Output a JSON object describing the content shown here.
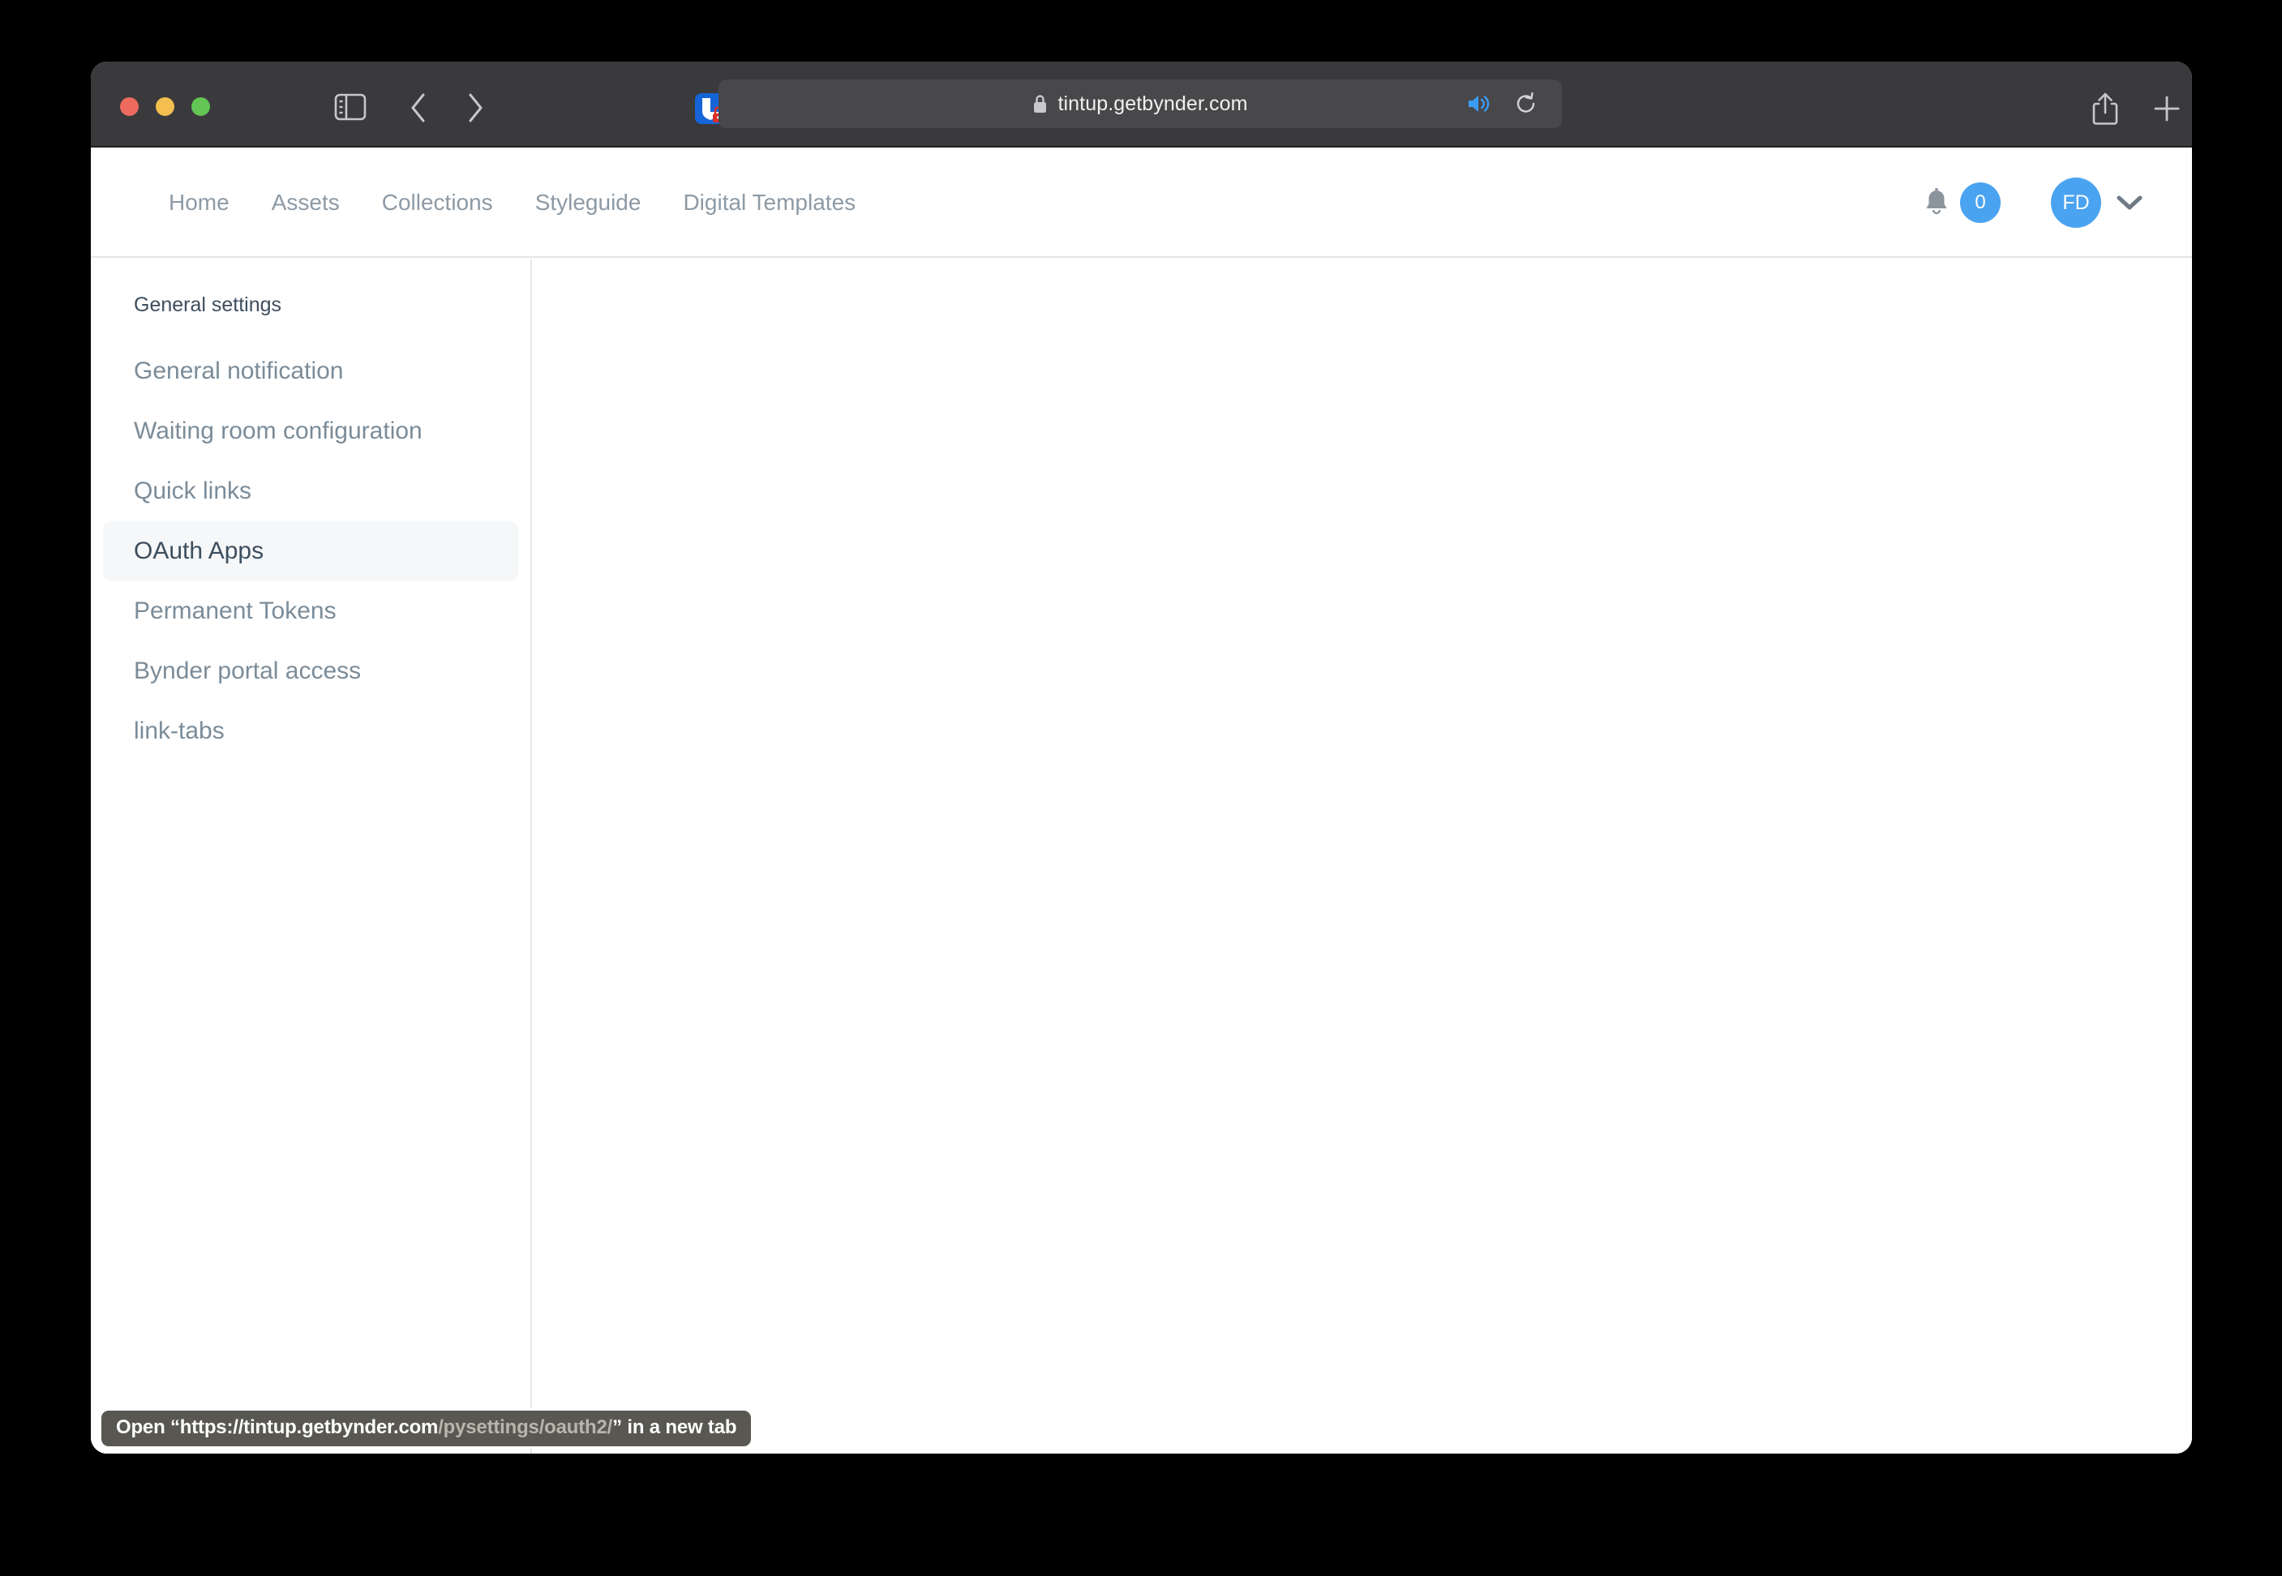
{
  "browser": {
    "traffic_lights": {
      "close": "close-window",
      "minimize": "minimize-window",
      "maximize": "maximize-window"
    },
    "url": "tintup.getbynder.com",
    "icons": {
      "sidebar_toggle": "sidebar-toggle-icon",
      "back": "nav-back-icon",
      "forward": "nav-forward-icon",
      "extension": "extension-icon",
      "shield": "shield-icon",
      "lock": "url-lock-icon",
      "speaker": "url-speaker-icon",
      "reload": "url-reload-icon",
      "share": "share-icon",
      "new_tab": "new-tab-icon",
      "tab_overview": "tab-overview-icon"
    },
    "colors": {
      "chrome_bg": "#3a3a3c",
      "url_field_bg": "#48474a",
      "speaker_blue": "#3b9cf5"
    }
  },
  "app": {
    "nav": [
      {
        "label": "Home"
      },
      {
        "label": "Assets"
      },
      {
        "label": "Collections"
      },
      {
        "label": "Styleguide"
      },
      {
        "label": "Digital Templates"
      }
    ],
    "nav_right": {
      "bell_icon": "bell-icon",
      "notification_count": "0",
      "avatar_initials": "FD",
      "chevron_icon": "chevron-down-icon"
    },
    "colors": {
      "accent_blue": "#4aa3f0",
      "nav_text": "#8d9aa5",
      "heading_text": "#3d4e5e",
      "selected_bg": "#f5f7f9",
      "border": "#e3e6e9"
    }
  },
  "sidebar": {
    "header": "General settings",
    "items": [
      {
        "label": "General notification",
        "selected": false
      },
      {
        "label": "Waiting room configuration",
        "selected": false
      },
      {
        "label": "Quick links",
        "selected": false
      },
      {
        "label": "OAuth Apps",
        "selected": true
      },
      {
        "label": "Permanent Tokens",
        "selected": false
      },
      {
        "label": "Bynder portal access",
        "selected": false
      },
      {
        "label": "link-tabs",
        "selected": false
      }
    ]
  },
  "status_tooltip": {
    "prefix": "Open “https://tintup.getbynder.com",
    "path": "/pysettings/oauth2/",
    "suffix": "” in a new tab"
  }
}
